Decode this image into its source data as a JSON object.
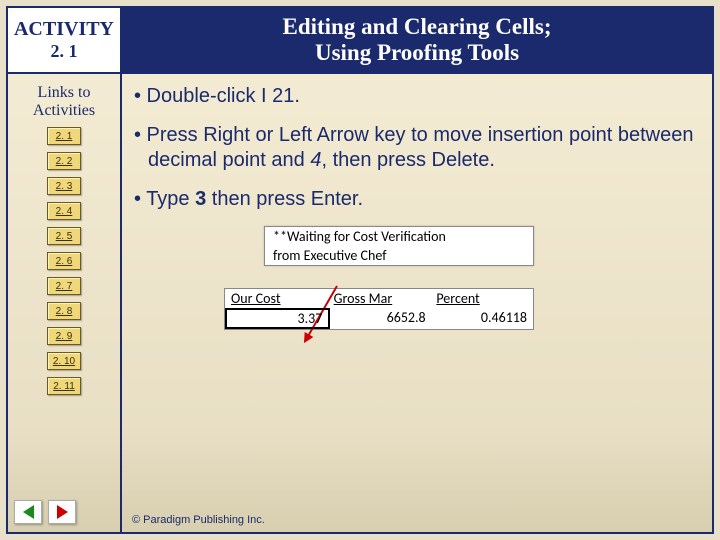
{
  "activity": {
    "label": "ACTIVITY",
    "number": "2. 1"
  },
  "title": {
    "line1": "Editing and Clearing Cells;",
    "line2": "Using Proofing Tools"
  },
  "sidebar": {
    "heading": "Links to Activities",
    "links": [
      "2. 1",
      "2. 2",
      "2. 3",
      "2. 4",
      "2. 5",
      "2. 6",
      "2. 7",
      "2. 8",
      "2. 9",
      "2. 10",
      "2. 11"
    ]
  },
  "bullets": {
    "b1_pre": "• Double-click ",
    "b1_cell": "I21",
    "b1_post": ".",
    "b2_pre": "• Press Right or Left Arrow key to move insertion point between decimal point and ",
    "b2_em": "4",
    "b2_post": ", then press Delete.",
    "b3_pre": "• Type ",
    "b3_em": "3",
    "b3_post": " then press Enter."
  },
  "excel": {
    "top_r1": "**Waiting for Cost Verification",
    "top_r2": "from Executive Chef",
    "hdr_c1": "Our Cost",
    "hdr_c2": "Gross Mar",
    "hdr_c3": "Percent",
    "val_c1": "3.37",
    "val_c2": "6652.8",
    "val_c3": "0.46118"
  },
  "footer": "© Paradigm Publishing Inc."
}
